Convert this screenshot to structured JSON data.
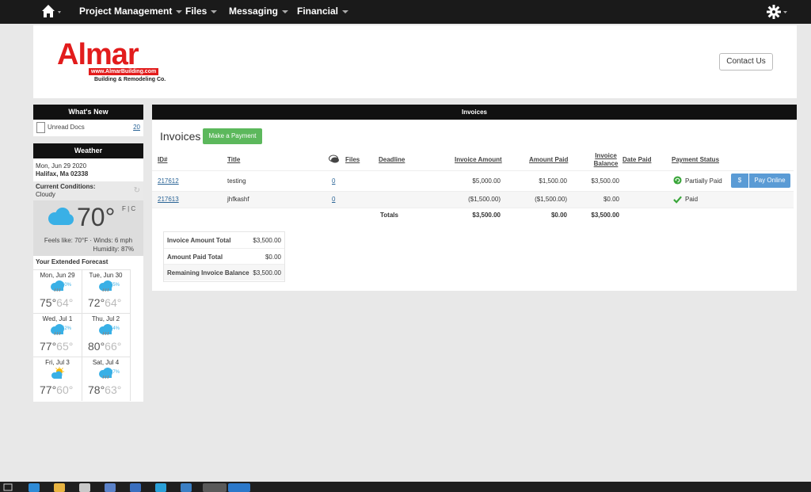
{
  "nav": {
    "items": [
      {
        "label": "Project Management"
      },
      {
        "label": "Files"
      },
      {
        "label": "Messaging"
      },
      {
        "label": "Financial"
      }
    ]
  },
  "header": {
    "logo_brand": "Almar",
    "logo_url": "www.AlmarBuilding.com",
    "logo_tagline": "Building & Remodeling Co.",
    "contact_label": "Contact Us"
  },
  "whats_new": {
    "title": "What's New",
    "items": [
      {
        "label": "Unread Docs",
        "count": "20"
      }
    ]
  },
  "weather": {
    "title": "Weather",
    "date": "Mon, Jun 29 2020",
    "location": "Halifax, Ma 02338",
    "conditions_label": "Current Conditions:",
    "conditions": "Cloudy",
    "temp": "70°",
    "units": "F | C",
    "feels_line": "Feels like: 70°F · Winds: 6 mph",
    "humidity": "Humidity: 87%",
    "extended_label": "Your Extended Forecast",
    "forecast": [
      {
        "day": "Mon, Jun 29",
        "pct": "40%",
        "hi": "75°",
        "lo": "64°"
      },
      {
        "day": "Tue, Jun 30",
        "pct": "55%",
        "hi": "72°",
        "lo": "64°"
      },
      {
        "day": "Wed, Jul 1",
        "pct": "52%",
        "hi": "77°",
        "lo": "65°"
      },
      {
        "day": "Thu, Jul 2",
        "pct": "54%",
        "hi": "80°",
        "lo": "66°"
      },
      {
        "day": "Fri, Jul 3",
        "pct": "",
        "hi": "77°",
        "lo": "60°"
      },
      {
        "day": "Sat, Jul 4",
        "pct": "37%",
        "hi": "78°",
        "lo": "63°"
      }
    ]
  },
  "invoices": {
    "panel_title": "Invoices",
    "heading": "Invoices",
    "make_payment_label": "Make a Payment",
    "columns": {
      "id": "ID#",
      "title": "Title",
      "files": "Files",
      "deadline": "Deadline",
      "invoice_amount": "Invoice Amount",
      "amount_paid": "Amount Paid",
      "invoice_balance_1": "Invoice",
      "invoice_balance_2": "Balance",
      "date_paid": "Date Paid",
      "payment_status": "Payment Status"
    },
    "rows": [
      {
        "id": "217612",
        "title": "testing",
        "files": "0",
        "invoice_amount": "$5,000.00",
        "amount_paid": "$1,500.00",
        "balance": "$3,500.00",
        "status": "Partially Paid",
        "dollar_label": "$",
        "pay_online_label": "Pay Online"
      },
      {
        "id": "217613",
        "title": "jhfkashf",
        "files": "0",
        "invoice_amount": "($1,500.00)",
        "amount_paid": "($1,500.00)",
        "balance": "$0.00",
        "status": "Paid"
      }
    ],
    "totals": {
      "label": "Totals",
      "invoice_amount": "$3,500.00",
      "amount_paid": "$0.00",
      "balance": "$3,500.00"
    },
    "summary": [
      {
        "label": "Invoice Amount Total",
        "value": "$3,500.00"
      },
      {
        "label": "Amount Paid Total",
        "value": "$0.00"
      },
      {
        "label": "Remaining Invoice Balance",
        "value": "$3,500.00"
      }
    ]
  },
  "colors": {
    "nav_bg": "#1a1a1a",
    "brand_red": "#e21c1c",
    "green": "#5cb85c",
    "pay_blue": "#5a9bd5",
    "weather_blue": "#39b0e6"
  }
}
